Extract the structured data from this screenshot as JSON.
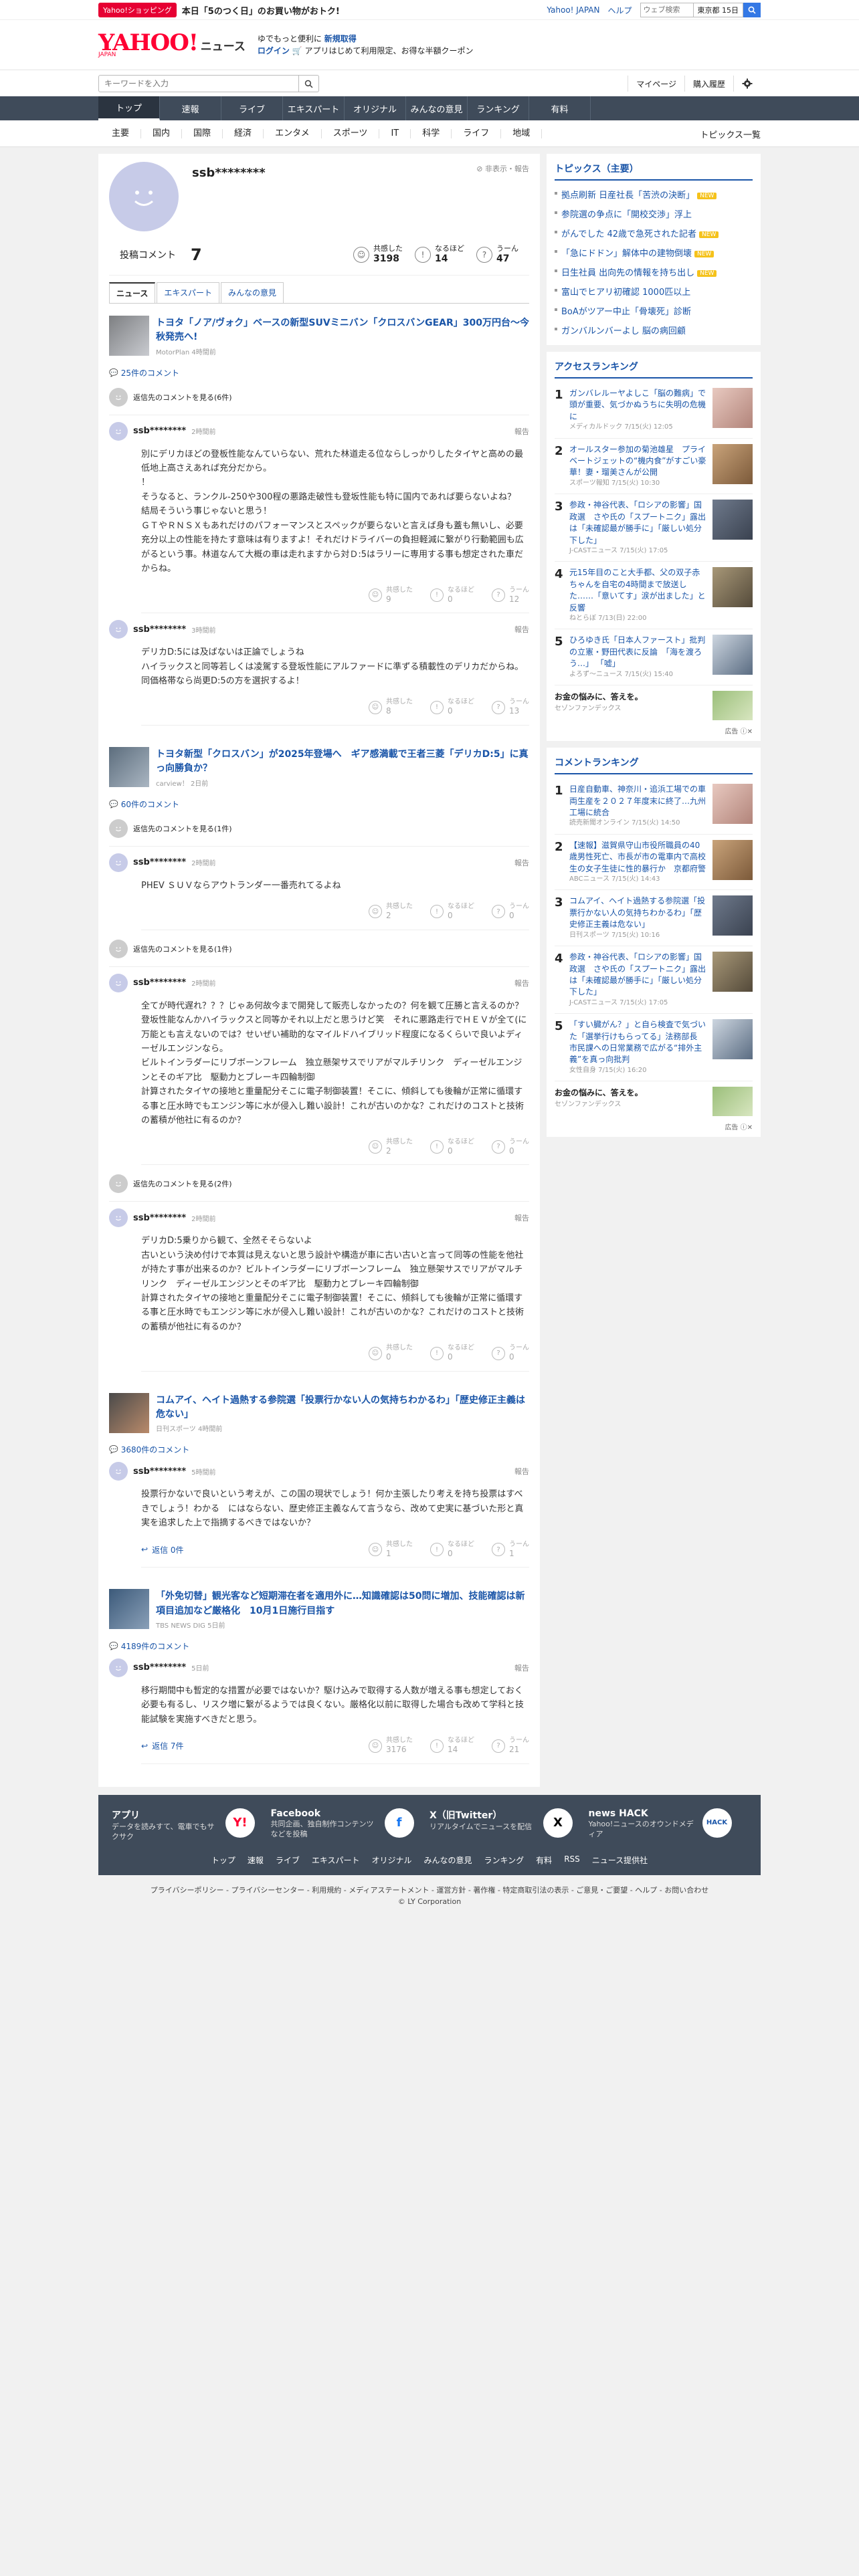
{
  "strip": {
    "shop_badge": "Yahoo!ショッピング",
    "shop_text": "本日「5のつく日」のお買い物がおトク!",
    "links": [
      "Yahoo! JAPAN",
      "ヘルプ"
    ],
    "web_search_placeholder": "ウェブ検索",
    "weather": "東京都 15日"
  },
  "header": {
    "logo": "YAHOO!",
    "logo_sub": "JAPAN",
    "service": "ニュース",
    "promo_line1_a": "ゆでもっと便利に",
    "promo_line1_b": "新規取得",
    "promo_line2_a": "ログイン",
    "promo_line2_b": "アプリはじめて利用限定、お得な半額クーポン"
  },
  "search": {
    "placeholder": "キーワードを入力",
    "mypage": "マイページ",
    "history": "購入履歴"
  },
  "mainnav": [
    "トップ",
    "速報",
    "ライブ",
    "エキスパート",
    "オリジナル",
    "みんなの意見",
    "ランキング",
    "有料"
  ],
  "catnav": [
    "主要",
    "国内",
    "国際",
    "経済",
    "エンタメ",
    "スポーツ",
    "IT",
    "科学",
    "ライフ",
    "地域"
  ],
  "catnav_right": "トピックス一覧",
  "profile": {
    "name": "ssb********",
    "hide_report": "非表示・報告",
    "comments_label": "投稿コメント",
    "comments_count": "7",
    "kyokan_label": "共感した",
    "kyokan": "3198",
    "naruhodo_label": "なるほど",
    "naruhodo": "14",
    "uun_label": "うーん",
    "uun": "47",
    "tabs": [
      "ニュース",
      "エキスパート",
      "みんなの意見"
    ]
  },
  "labels": {
    "report": "報告",
    "kyokan": "共感した",
    "naruhodo": "なるほど",
    "uun": "うーん"
  },
  "articles": [
    {
      "title": "トヨタ「ノア/ヴォク」ベースの新型SUVミニバン「クロスバンGEAR」300万円台〜今秋発売へ!",
      "source": "MotorPlan 4時間前",
      "count": "25件のコメント",
      "blocks": [
        {
          "type": "deleted",
          "text": "返信先のコメントを見る(6件)"
        },
        {
          "type": "comment",
          "name": "ssb********",
          "time": "2時間前",
          "text": "別にデリカほどの登板性能なんていらない、荒れた林道走る位ならしっかりしたタイヤと高めの最低地上高さえあれば充分だから。\n！\nそうなると、ランクル-250や300程の悪路走破性も登坂性能も特に国内であれば要らないよね？　結局そういう事じゃないと思う！\nＧＴやＲＮＳＸもあれだけのパフォーマンスとスペックが要らないと言えば身も蓋も無いし、必要充分以上の性能を持たす意味は有りますよ！それだけドライバーの負担軽減に繋がり行動範囲も広がるという事。林道なんて大概の車は走れますから対Ｄ:5はラリーに専用する事も想定された車だからね。",
          "kyokan": "9",
          "naruhodo": "0",
          "uun": "12",
          "replies": ""
        },
        {
          "type": "comment",
          "name": "ssb********",
          "time": "3時間前",
          "text": "デリカD:5には及ばないは正論でしょうね\nハイラックスと同等若しくは凌駕する登坂性能にアルファードに準ずる積載性のデリカだからね。同価格帯なら尚更D:5の方を選択するよ！",
          "kyokan": "8",
          "naruhodo": "0",
          "uun": "13",
          "replies": ""
        }
      ]
    },
    {
      "title": "トヨタ新型「クロスバン」が2025年登場へ　ギア感満載で王者三菱「デリカD:5」に真っ向勝負か？",
      "source": "carview！ 2日前",
      "count": "60件のコメント",
      "blocks": [
        {
          "type": "deleted",
          "text": "返信先のコメントを見る(1件)"
        },
        {
          "type": "comment",
          "name": "ssb********",
          "time": "2時間前",
          "text": "PHEV ＳＵＶならアウトランダー一番売れてるよね",
          "kyokan": "2",
          "naruhodo": "0",
          "uun": "0",
          "replies": ""
        },
        {
          "type": "deleted",
          "text": "返信先のコメントを見る(1件)"
        },
        {
          "type": "comment",
          "name": "ssb********",
          "time": "2時間前",
          "text": "全てが時代遅れ？？？じゃあ何故今まで開発して販売しなかったの？何を観て圧勝と言えるのか？登坂性能なんかハイラックスと同等かそれ以上だと思うけど笑　それに悪路走行でＨＥＶが全て(に万能とも言えないのでは？せいぜい補助的なマイルドハイブリッド程度になるくらいで良いよディーゼルエンジンなら。\nビルトインラダーにリブボーンフレーム　独立懸架サスでリアがマルチリンク　ディーゼルエンジンとそのギア比　駆動力とブレーキ四輪制御\n計算されたタイヤの接地と重量配分そこに電子制御装置！そこに、傾斜しても後輪が正常に循環する事と圧水時でもエンジン等に水が侵入し難い設計！これが古いのかな？これだけのコストと技術の蓄積が他社に有るのか？",
          "kyokan": "2",
          "naruhodo": "0",
          "uun": "0",
          "replies": ""
        },
        {
          "type": "deleted",
          "text": "返信先のコメントを見る(2件)"
        },
        {
          "type": "comment",
          "name": "ssb********",
          "time": "2時間前",
          "text": "デリカD:5乗りから観て、全然そそらないよ\n古いという決め付けで本質は見えないと思う設計や構造が車に古い古いと言って同等の性能を他社が持たす事が出来るのか？ビルトインラダーにリブボーンフレーム　独立懸架サスでリアがマルチリンク　ディーゼルエンジンとそのギア比　駆動力とブレーキ四輪制御\n計算されたタイヤの接地と重量配分そこに電子制御装置！そこに、傾斜しても後輪が正常に循環する事と圧水時でもエンジン等に水が侵入し難い設計！これが古いのかな？これだけのコストと技術の蓄積が他社に有るのか？",
          "kyokan": "0",
          "naruhodo": "0",
          "uun": "0",
          "replies": ""
        }
      ]
    },
    {
      "title": "コムアイ、ヘイト過熱する参院選「投票行かない人の気持ちわかるわ」「歴史修正主義は危ない」",
      "source": "日刊スポーツ 4時間前",
      "count": "3680件のコメント",
      "blocks": [
        {
          "type": "comment",
          "name": "ssb********",
          "time": "5時間前",
          "text": "投票行かないで良いという考えが、この国の現状でしょう！何か主張したり考えを持ち投票はすべきでしょう！わかる　にはならない、歴史修正主義なんて言うなら、改めて史実に基づいた形と真実を追求した上で指摘するべきではないか？",
          "kyokan": "1",
          "naruhodo": "0",
          "uun": "1",
          "replies": "返信 0件"
        }
      ]
    },
    {
      "title": "「外免切替」観光客など短期滞在者を適用外に…知識確認は50問に増加、技能確認は新項目追加など厳格化　10月1日施行目指す",
      "source": "TBS NEWS DIG 5日前",
      "count": "4189件のコメント",
      "blocks": [
        {
          "type": "comment",
          "name": "ssb********",
          "time": "5日前",
          "text": "移行期間中も暫定的な措置が必要ではないか？駆け込みで取得する人数が増える事も想定しておく必要も有るし、リスク増に繋がるようでは良くない。厳格化以前に取得した場合も改めて学科と技能試験を実施すべきだと思う。",
          "kyokan": "3176",
          "naruhodo": "14",
          "uun": "21",
          "replies": "返信 7件"
        }
      ]
    }
  ],
  "sidebar": {
    "topics_title": "トピックス（主要）",
    "topics": [
      {
        "text": "拠点刷新 日産社長「苦渋の決断」",
        "new": true
      },
      {
        "text": "参院選の争点に「開校交渉」浮上",
        "new": false
      },
      {
        "text": "がんでした 42歳で急死された記者",
        "new": true
      },
      {
        "text": "「急にドドン」解体中の建物倒壊",
        "new": true
      },
      {
        "text": "日生社員 出向先の情報を持ち出し",
        "new": true
      },
      {
        "text": "富山でヒアリ初確認 1000匹以上",
        "new": false
      },
      {
        "text": "BoAがツアー中止「骨壊死」診断",
        "new": false
      },
      {
        "text": "ガンバルンバーよし 脳の病回顧",
        "new": false
      }
    ],
    "access_title": "アクセスランキング",
    "access": [
      {
        "n": "1",
        "text": "ガンバレルーヤよしこ「脳の難病」で頭が重要、気づかぬうちに失明の危機に",
        "meta": "メディカルドック 7/15(火) 12:05"
      },
      {
        "n": "2",
        "text": "オールスター参加の菊池雄星　プライベートジェットの“機内食”がすごい豪華！妻・瑠美さんが公開",
        "meta": "スポーツ報知 7/15(火) 10:30"
      },
      {
        "n": "3",
        "text": "参政・神谷代表、「ロシアの影響」国政選　さや氏の「スプートニク」露出は「未確認最が勝手に」「厳しい処分下した」",
        "meta": "J-CASTニュース 7/15(火) 17:05"
      },
      {
        "n": "4",
        "text": "元15年目のこと大手都、父の双子赤ちゃんを自宅の4時間まで放送した……「意いてす」涙が出ました」と反響",
        "meta": "ねとらぼ 7/13(日) 22:00"
      },
      {
        "n": "5",
        "text": "ひろゆき氏「日本人ファースト」批判の立憲・野田代表に反論　「海を渡ろう…」 「嘘」",
        "meta": "よろず〜ニュース 7/15(火) 15:40"
      }
    ],
    "ad_title": "お金の悩みに、答えを。",
    "ad_sponsor": "セゾンファンデックス",
    "ad_foot": "広告",
    "comment_rank_title": "コメントランキング",
    "comment_rank": [
      {
        "n": "1",
        "text": "日産自動車、神奈川・追浜工場での車両生産を２０２７年度末に終了…九州工場に統合",
        "meta": "読売新聞オンライン 7/15(火) 14:50"
      },
      {
        "n": "2",
        "text": "【速報】滋賀県守山市役所職員の40歳男性死亡、市長が市の電車内で高校生の女子生徒に性的暴行か　京都府警",
        "meta": "ABCニュース 7/15(火) 14:43"
      },
      {
        "n": "3",
        "text": "コムアイ、ヘイト過熱する参院選「投票行かない人の気持ちわかるわ」「歴史修正主義は危ない」",
        "meta": "日刊スポーツ 7/15(火) 10:16"
      },
      {
        "n": "4",
        "text": "参政・神谷代表、「ロシアの影響」国政選　さや氏の「スプートニク」露出は「未確認最が勝手に」「厳しい処分下した」",
        "meta": "J-CASTニュース 7/15(火) 17:05"
      },
      {
        "n": "5",
        "text": "「すい臓がん？」と自ら検査で気づいた「選挙行けもらってる」法務部長　市民課への日常業務で広がる“排外主義”を真っ向批判",
        "meta": "女性自身 7/15(火) 16:20"
      }
    ]
  },
  "footer": {
    "apps": [
      {
        "h": "アプリ",
        "d": "データを読みすて、電車でもサクサク"
      },
      {
        "h": "Facebook",
        "d": "共同企画、独自制作コンテンツなどを投稿"
      },
      {
        "h": "X（旧Twitter）",
        "d": "リアルタイムでニュースを配信"
      },
      {
        "h": "news HACK",
        "d": "Yahoo!ニュースのオウンドメディア"
      }
    ],
    "links": [
      "トップ",
      "速報",
      "ライブ",
      "エキスパート",
      "オリジナル",
      "みんなの意見",
      "ランキング",
      "有料",
      "RSS",
      "ニュース提供社"
    ],
    "legal1": "プライバシーポリシー - プライバシーセンター - 利用規約 - メディアステートメント - 運営方針 - 著作権 - 特定商取引法の表示 - ご意見・ご要望 - ヘルプ - お問い合わせ",
    "legal2": "© LY Corporation"
  }
}
